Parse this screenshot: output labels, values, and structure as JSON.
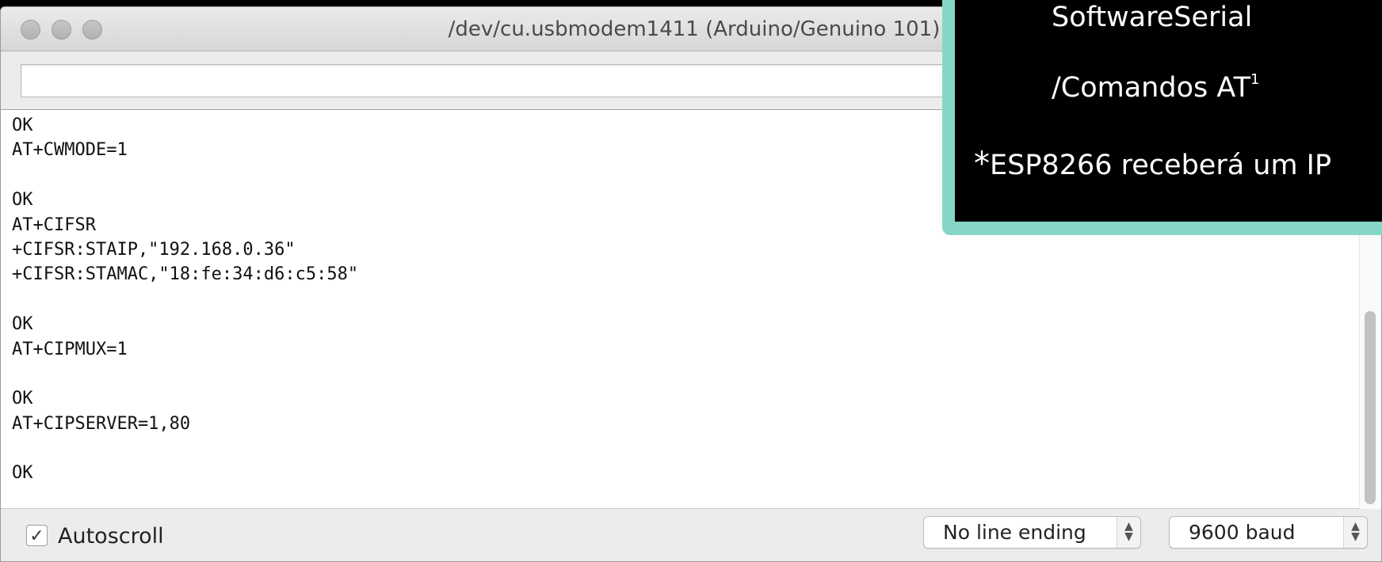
{
  "window": {
    "title": "/dev/cu.usbmodem1411 (Arduino/Genuino 101)"
  },
  "send": {
    "value": ""
  },
  "console": {
    "lines": [
      "OK",
      "AT+CWMODE=1",
      "",
      "OK",
      "AT+CIFSR",
      "+CIFSR:STAIP,\"192.168.0.36\"",
      "+CIFSR:STAMAC,\"18:fe:34:d6:c5:58\"",
      "",
      "OK",
      "AT+CIPMUX=1",
      "",
      "OK",
      "AT+CIPSERVER=1,80",
      "",
      "OK"
    ]
  },
  "bottom": {
    "autoscroll_label": "Autoscroll",
    "autoscroll_checked": true,
    "check_glyph": "✓",
    "line_ending": "No line ending",
    "baud": "9600 baud",
    "select_arrows_up": "▲",
    "select_arrows_down": "▼"
  },
  "overlay": {
    "line1": "SoftwareSerial",
    "line2": "/Comandos AT",
    "line2_sup": "1",
    "line3_star": "*",
    "line3": "ESP8266 receberá um IP",
    "accent_color": "#86d6c8"
  }
}
